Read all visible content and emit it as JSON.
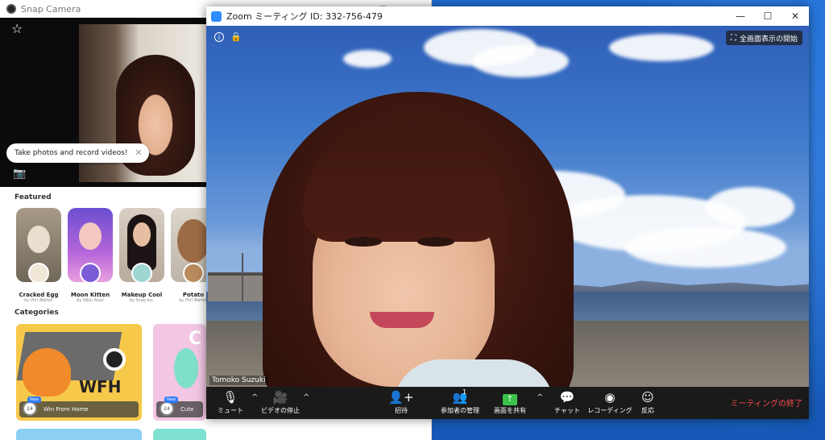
{
  "snap": {
    "title": "Snap Camera",
    "tooltip": "Take photos and record videos!",
    "featured_title": "Featured",
    "categories_title": "Categories",
    "lenses": [
      {
        "name": "Cracked Egg",
        "author": "by Phil Walton"
      },
      {
        "name": "Moon Kitten",
        "author": "by Nikki Avail"
      },
      {
        "name": "Makeup Cool",
        "author": "by Snap Inc."
      },
      {
        "name": "Potato",
        "author": "by Phil Walton"
      }
    ],
    "categories": [
      {
        "label": "Win From Home",
        "badge": "24",
        "new": "New",
        "art_text": "WFH"
      },
      {
        "label": "Cute",
        "badge": "24",
        "new": "New"
      }
    ]
  },
  "zoom": {
    "title": "Zoom ミーティング ID: 332-756-479",
    "fullscreen_label": "全画面表示の開始",
    "participant_name": "Tomoko Suzuki",
    "toolbar": {
      "mute": "ミュート",
      "video_stop": "ビデオの停止",
      "invite": "招待",
      "manage_participants": "参加者の管理",
      "participant_count": "1",
      "share_screen": "画面を共有",
      "chat": "チャット",
      "recording": "レコーディング",
      "reactions": "反応",
      "end_meeting": "ミーティングの終了"
    }
  },
  "colors": {
    "zoom_blue": "#2d8cff",
    "end_red": "#ff4b4b",
    "share_green": "#3cc24a"
  }
}
